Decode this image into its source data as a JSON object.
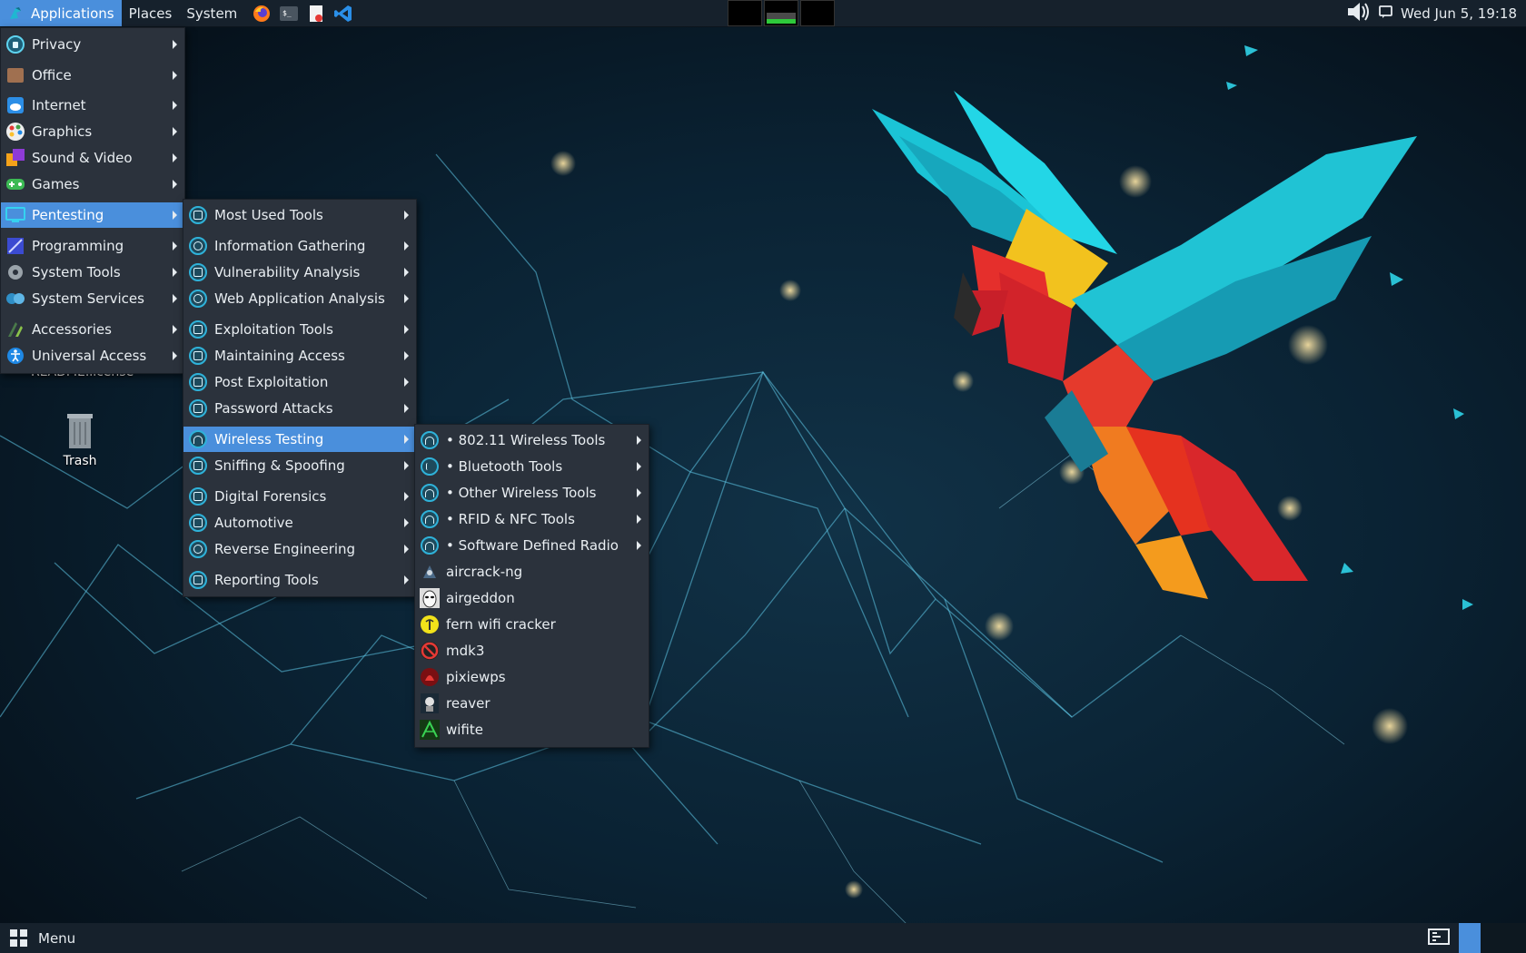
{
  "top_panel": {
    "applications_label": "Applications",
    "places_label": "Places",
    "system_label": "System",
    "launchers": [
      "firefox-icon",
      "terminal-icon",
      "text-editor-icon",
      "vscode-icon"
    ],
    "clock": "Wed Jun 5, 19:18"
  },
  "desktop": {
    "readme_label": "README.license",
    "trash_label": "Trash"
  },
  "main_menu": {
    "items": [
      {
        "label": "Privacy",
        "icon": "privacy-icon"
      },
      {
        "label": "Office",
        "icon": "office-icon"
      },
      {
        "label": "Internet",
        "icon": "internet-icon"
      },
      {
        "label": "Graphics",
        "icon": "graphics-icon"
      },
      {
        "label": "Sound & Video",
        "icon": "sound-video-icon"
      },
      {
        "label": "Games",
        "icon": "games-icon"
      },
      {
        "label": "Pentesting",
        "icon": "pentesting-icon",
        "highlighted": true
      },
      {
        "label": "Programming",
        "icon": "programming-icon"
      },
      {
        "label": "System Tools",
        "icon": "system-tools-icon"
      },
      {
        "label": "System Services",
        "icon": "system-services-icon"
      },
      {
        "label": "Accessories",
        "icon": "accessories-icon"
      },
      {
        "label": "Universal Access",
        "icon": "universal-access-icon"
      }
    ]
  },
  "pentesting_menu": {
    "items": [
      {
        "label": "Most Used Tools"
      },
      {
        "label": "Information Gathering"
      },
      {
        "label": "Vulnerability Analysis"
      },
      {
        "label": "Web Application Analysis"
      },
      {
        "label": "Exploitation Tools"
      },
      {
        "label": "Maintaining Access"
      },
      {
        "label": "Post Exploitation"
      },
      {
        "label": "Password Attacks"
      },
      {
        "label": "Wireless Testing",
        "highlighted": true
      },
      {
        "label": "Sniffing & Spoofing"
      },
      {
        "label": "Digital Forensics"
      },
      {
        "label": "Automotive"
      },
      {
        "label": "Reverse Engineering"
      },
      {
        "label": "Reporting Tools"
      }
    ]
  },
  "wireless_menu": {
    "items": [
      {
        "label": "• 802.11 Wireless Tools",
        "submenu": true
      },
      {
        "label": "• Bluetooth Tools",
        "submenu": true
      },
      {
        "label": "• Other Wireless Tools",
        "submenu": true
      },
      {
        "label": "• RFID & NFC Tools",
        "submenu": true
      },
      {
        "label": "• Software Defined Radio",
        "submenu": true
      },
      {
        "label": "aircrack-ng",
        "submenu": false
      },
      {
        "label": "airgeddon",
        "submenu": false
      },
      {
        "label": "fern wifi cracker",
        "submenu": false
      },
      {
        "label": "mdk3",
        "submenu": false
      },
      {
        "label": "pixiewps",
        "submenu": false
      },
      {
        "label": "reaver",
        "submenu": false
      },
      {
        "label": "wifite",
        "submenu": false
      }
    ]
  },
  "bottom_panel": {
    "menu_label": "Menu"
  },
  "colors": {
    "highlight": "#4a8fdc",
    "menu_bg": "#2b323c",
    "panel_bg": "#16212c",
    "accent_cyan": "#2fb2d9"
  }
}
